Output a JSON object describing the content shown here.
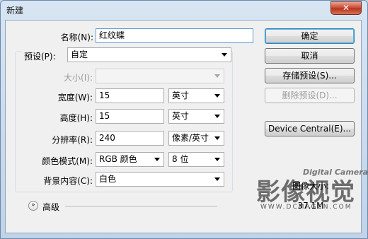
{
  "window": {
    "title": "新建",
    "close_glyph": "✕"
  },
  "name": {
    "label": "名称(N):",
    "value": "红纹蝶"
  },
  "preset": {
    "label": "预设(P):",
    "value": "自定"
  },
  "size": {
    "label": "大小(I):",
    "value": ""
  },
  "width": {
    "label": "宽度(W):",
    "value": "15",
    "unit": "英寸"
  },
  "height": {
    "label": "高度(H):",
    "value": "15",
    "unit": "英寸"
  },
  "resolution": {
    "label": "分辨率(R):",
    "value": "240",
    "unit": "像素/英寸"
  },
  "color_mode": {
    "label": "颜色模式(M):",
    "mode": "RGB 颜色",
    "depth": "8 位"
  },
  "background": {
    "label": "背景内容(C):",
    "value": "白色"
  },
  "advanced": {
    "label": "高级",
    "icon": "double-chevron-down-icon"
  },
  "buttons": {
    "ok": "确定",
    "cancel": "取消",
    "save_preset": "存储预设(S)...",
    "delete_preset": "删除预设(D)...",
    "device_central": "Device Central(E)..."
  },
  "image_size": {
    "label": "图像大小:",
    "value": "37.1M"
  },
  "watermark": {
    "text": "影像视觉",
    "url": "WWW.DCMAGCN.COM",
    "brand": "Digital Camera"
  }
}
